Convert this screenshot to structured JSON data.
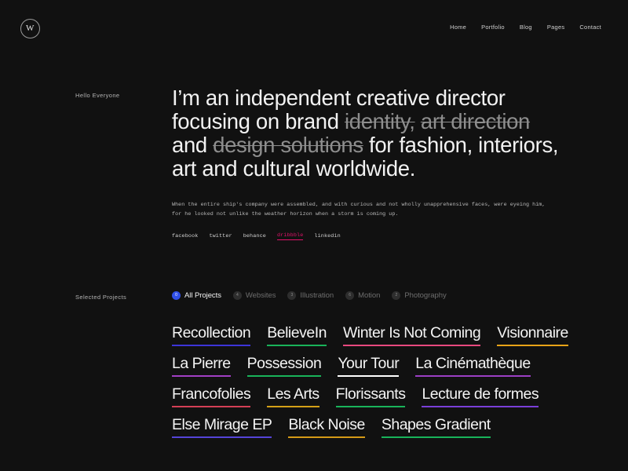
{
  "brand": {
    "logo_mark": "W",
    "logo_icon": "circled-w-logo-icon"
  },
  "nav": {
    "items": [
      {
        "label": "Home"
      },
      {
        "label": "Portfolio"
      },
      {
        "label": "Blog"
      },
      {
        "label": "Pages"
      },
      {
        "label": "Contact"
      }
    ]
  },
  "hero": {
    "side_label": "Hello Everyone",
    "headline": {
      "part1": "I’m an independent creative director focusing on brand ",
      "strike1": "identity,",
      "part2": " ",
      "strike2": "art direction",
      "part3": " and ",
      "strike3": "design solutions",
      "part4": " for fashion, interiors, art and cultural worldwide."
    },
    "paragraph": "When the entire ship's company were assembled, and with curious and not wholly unapprehensive faces, were eyeing him, for he looked not unlike the weather horizon when a storm is coming up.",
    "socials": [
      {
        "label": "facebook",
        "active": false
      },
      {
        "label": "twitter",
        "active": false
      },
      {
        "label": "behance",
        "active": false
      },
      {
        "label": "dribbble",
        "active": true
      },
      {
        "label": "linkedin",
        "active": false
      }
    ],
    "accent_color": "#e0136a"
  },
  "projects_section": {
    "side_label": "Selected Projects",
    "active_filter_color": "#2f4fe8",
    "filters": [
      {
        "label": "All Projects",
        "count": "0",
        "active": true
      },
      {
        "label": "Websites",
        "count": "4",
        "active": false
      },
      {
        "label": "Illustration",
        "count": "3",
        "active": false
      },
      {
        "label": "Motion",
        "count": "6",
        "active": false
      },
      {
        "label": "Photography",
        "count": "2",
        "active": false
      }
    ],
    "items": [
      {
        "title": "Recollection",
        "underline": "#3d35d8"
      },
      {
        "title": "BelieveIn",
        "underline": "#19b35a"
      },
      {
        "title": "Winter Is Not Coming",
        "underline": "#e8497e"
      },
      {
        "title": "Visionnaire",
        "underline": "#e8a317"
      },
      {
        "title": "La Pierre",
        "underline": "#a13fc4"
      },
      {
        "title": "Possession",
        "underline": "#19b35a"
      },
      {
        "title": "Your Tour",
        "underline": "#ffffff"
      },
      {
        "title": "La Cinémathèque",
        "underline": "#9b3fc4"
      },
      {
        "title": "Francofolies",
        "underline": "#d43f55"
      },
      {
        "title": "Les Arts",
        "underline": "#d4a017"
      },
      {
        "title": "Florissants",
        "underline": "#19b35a"
      },
      {
        "title": "Lecture de formes",
        "underline": "#7a3fd8"
      },
      {
        "title": "Else Mirage EP",
        "underline": "#5544d8"
      },
      {
        "title": "Black Noise",
        "underline": "#d49a17"
      },
      {
        "title": "Shapes Gradient",
        "underline": "#19b35a"
      }
    ]
  }
}
